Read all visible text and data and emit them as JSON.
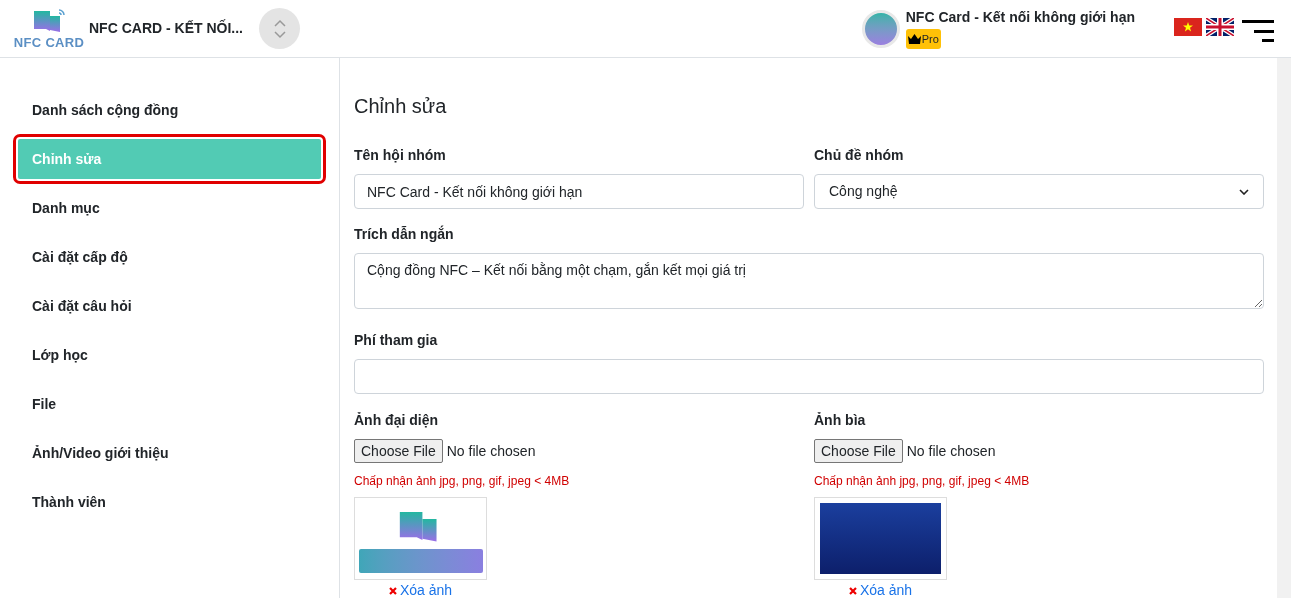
{
  "header": {
    "logo_text": "NFC CARD",
    "title": "NFC CARD - KẾT NỐI...",
    "account": {
      "name": "NFC Card - Kết nối không giới hạn",
      "badge": "Pro"
    }
  },
  "sidebar": {
    "items": [
      {
        "label": "Danh sách cộng đồng",
        "selected": false
      },
      {
        "label": "Chỉnh sửa",
        "selected": true
      },
      {
        "label": "Danh mục",
        "selected": false
      },
      {
        "label": "Cài đặt cấp độ",
        "selected": false
      },
      {
        "label": "Cài đặt câu hỏi",
        "selected": false
      },
      {
        "label": "Lớp học",
        "selected": false
      },
      {
        "label": "File",
        "selected": false
      },
      {
        "label": "Ảnh/Video giới thiệu",
        "selected": false
      },
      {
        "label": "Thành viên",
        "selected": false
      }
    ]
  },
  "form": {
    "heading": "Chỉnh sửa",
    "group_name": {
      "label": "Tên hội nhóm",
      "value": "NFC Card - Kết nối không giới hạn"
    },
    "topic": {
      "label": "Chủ đề nhóm",
      "value": "Công nghệ"
    },
    "quote": {
      "label": "Trích dẫn ngắn",
      "value": "Cộng đồng NFC – Kết nối bằng một chạm, gắn kết mọi giá trị"
    },
    "fee": {
      "label": "Phí tham gia"
    },
    "uploads": [
      {
        "kind": "logo",
        "label": "Ảnh đại diện",
        "button": "Choose File",
        "status": "No file chosen",
        "hint": "Chấp nhận ảnh jpg, png, gif, jpeg < 4MB",
        "remove": "Xóa ảnh"
      },
      {
        "kind": "photo",
        "label": "Ảnh bìa",
        "button": "Choose File",
        "status": "No file chosen",
        "hint": "Chấp nhận ảnh jpg, png, gif, jpeg < 4MB",
        "remove": "Xóa ảnh"
      }
    ]
  }
}
